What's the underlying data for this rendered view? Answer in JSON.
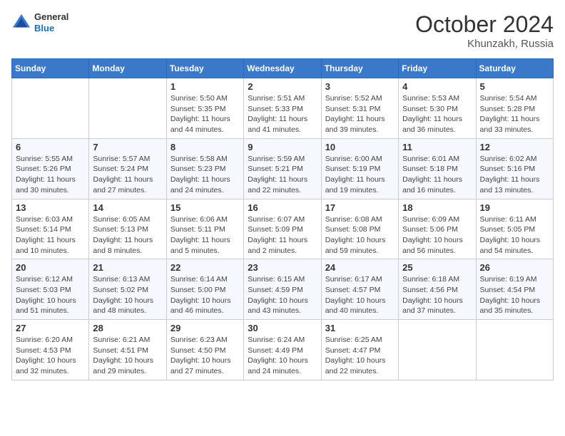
{
  "logo": {
    "line1": "General",
    "line2": "Blue"
  },
  "title": "October 2024",
  "location": "Khunzakh, Russia",
  "days_header": [
    "Sunday",
    "Monday",
    "Tuesday",
    "Wednesday",
    "Thursday",
    "Friday",
    "Saturday"
  ],
  "weeks": [
    [
      {
        "day": "",
        "info": ""
      },
      {
        "day": "",
        "info": ""
      },
      {
        "day": "1",
        "info": "Sunrise: 5:50 AM\nSunset: 5:35 PM\nDaylight: 11 hours and 44 minutes."
      },
      {
        "day": "2",
        "info": "Sunrise: 5:51 AM\nSunset: 5:33 PM\nDaylight: 11 hours and 41 minutes."
      },
      {
        "day": "3",
        "info": "Sunrise: 5:52 AM\nSunset: 5:31 PM\nDaylight: 11 hours and 39 minutes."
      },
      {
        "day": "4",
        "info": "Sunrise: 5:53 AM\nSunset: 5:30 PM\nDaylight: 11 hours and 36 minutes."
      },
      {
        "day": "5",
        "info": "Sunrise: 5:54 AM\nSunset: 5:28 PM\nDaylight: 11 hours and 33 minutes."
      }
    ],
    [
      {
        "day": "6",
        "info": "Sunrise: 5:55 AM\nSunset: 5:26 PM\nDaylight: 11 hours and 30 minutes."
      },
      {
        "day": "7",
        "info": "Sunrise: 5:57 AM\nSunset: 5:24 PM\nDaylight: 11 hours and 27 minutes."
      },
      {
        "day": "8",
        "info": "Sunrise: 5:58 AM\nSunset: 5:23 PM\nDaylight: 11 hours and 24 minutes."
      },
      {
        "day": "9",
        "info": "Sunrise: 5:59 AM\nSunset: 5:21 PM\nDaylight: 11 hours and 22 minutes."
      },
      {
        "day": "10",
        "info": "Sunrise: 6:00 AM\nSunset: 5:19 PM\nDaylight: 11 hours and 19 minutes."
      },
      {
        "day": "11",
        "info": "Sunrise: 6:01 AM\nSunset: 5:18 PM\nDaylight: 11 hours and 16 minutes."
      },
      {
        "day": "12",
        "info": "Sunrise: 6:02 AM\nSunset: 5:16 PM\nDaylight: 11 hours and 13 minutes."
      }
    ],
    [
      {
        "day": "13",
        "info": "Sunrise: 6:03 AM\nSunset: 5:14 PM\nDaylight: 11 hours and 10 minutes."
      },
      {
        "day": "14",
        "info": "Sunrise: 6:05 AM\nSunset: 5:13 PM\nDaylight: 11 hours and 8 minutes."
      },
      {
        "day": "15",
        "info": "Sunrise: 6:06 AM\nSunset: 5:11 PM\nDaylight: 11 hours and 5 minutes."
      },
      {
        "day": "16",
        "info": "Sunrise: 6:07 AM\nSunset: 5:09 PM\nDaylight: 11 hours and 2 minutes."
      },
      {
        "day": "17",
        "info": "Sunrise: 6:08 AM\nSunset: 5:08 PM\nDaylight: 10 hours and 59 minutes."
      },
      {
        "day": "18",
        "info": "Sunrise: 6:09 AM\nSunset: 5:06 PM\nDaylight: 10 hours and 56 minutes."
      },
      {
        "day": "19",
        "info": "Sunrise: 6:11 AM\nSunset: 5:05 PM\nDaylight: 10 hours and 54 minutes."
      }
    ],
    [
      {
        "day": "20",
        "info": "Sunrise: 6:12 AM\nSunset: 5:03 PM\nDaylight: 10 hours and 51 minutes."
      },
      {
        "day": "21",
        "info": "Sunrise: 6:13 AM\nSunset: 5:02 PM\nDaylight: 10 hours and 48 minutes."
      },
      {
        "day": "22",
        "info": "Sunrise: 6:14 AM\nSunset: 5:00 PM\nDaylight: 10 hours and 46 minutes."
      },
      {
        "day": "23",
        "info": "Sunrise: 6:15 AM\nSunset: 4:59 PM\nDaylight: 10 hours and 43 minutes."
      },
      {
        "day": "24",
        "info": "Sunrise: 6:17 AM\nSunset: 4:57 PM\nDaylight: 10 hours and 40 minutes."
      },
      {
        "day": "25",
        "info": "Sunrise: 6:18 AM\nSunset: 4:56 PM\nDaylight: 10 hours and 37 minutes."
      },
      {
        "day": "26",
        "info": "Sunrise: 6:19 AM\nSunset: 4:54 PM\nDaylight: 10 hours and 35 minutes."
      }
    ],
    [
      {
        "day": "27",
        "info": "Sunrise: 6:20 AM\nSunset: 4:53 PM\nDaylight: 10 hours and 32 minutes."
      },
      {
        "day": "28",
        "info": "Sunrise: 6:21 AM\nSunset: 4:51 PM\nDaylight: 10 hours and 29 minutes."
      },
      {
        "day": "29",
        "info": "Sunrise: 6:23 AM\nSunset: 4:50 PM\nDaylight: 10 hours and 27 minutes."
      },
      {
        "day": "30",
        "info": "Sunrise: 6:24 AM\nSunset: 4:49 PM\nDaylight: 10 hours and 24 minutes."
      },
      {
        "day": "31",
        "info": "Sunrise: 6:25 AM\nSunset: 4:47 PM\nDaylight: 10 hours and 22 minutes."
      },
      {
        "day": "",
        "info": ""
      },
      {
        "day": "",
        "info": ""
      }
    ]
  ]
}
